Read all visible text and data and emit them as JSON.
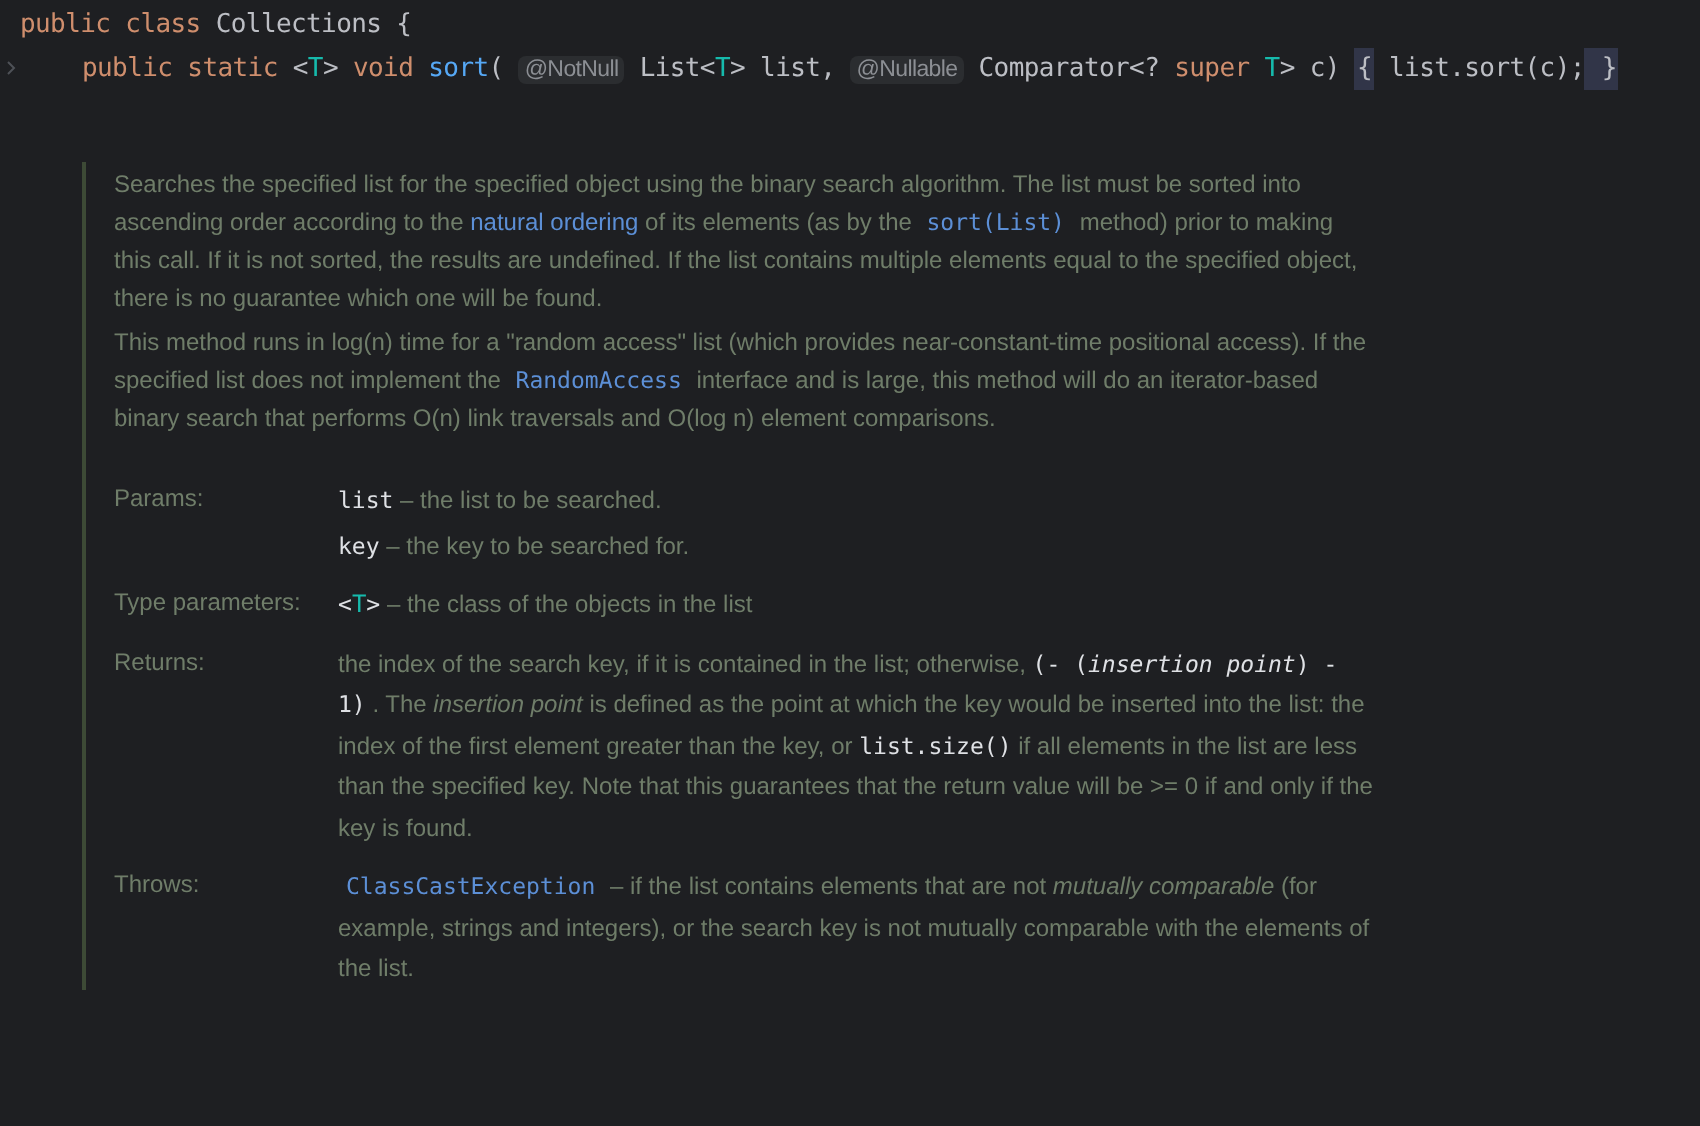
{
  "code_lines": [
    {
      "folded_gutter": false,
      "tokens": [
        {
          "kind": "keyword",
          "text": "public class "
        },
        {
          "kind": "plain",
          "text": "Collections {"
        }
      ],
      "children": [
        {
          "folded_gutter": true,
          "tokens": [
            {
              "kind": "keyword",
              "text": "public static "
            },
            {
              "kind": "plain",
              "text": "<"
            },
            {
              "kind": "typevar",
              "text": "T"
            },
            {
              "kind": "plain",
              "text": "> "
            },
            {
              "kind": "keyword",
              "text": "void "
            },
            {
              "kind": "method",
              "text": "sort"
            },
            {
              "kind": "plain",
              "text": "( "
            },
            {
              "kind": "annotation",
              "text": "@NotNull"
            },
            {
              "kind": "plain",
              "text": " List<"
            },
            {
              "kind": "typevar",
              "text": "T"
            },
            {
              "kind": "plain",
              "text": "> list, "
            },
            {
              "kind": "annotation",
              "text": "@Nullable"
            },
            {
              "kind": "plain",
              "text": " Comparator<? "
            },
            {
              "kind": "keyword",
              "text": "super "
            },
            {
              "kind": "typevar",
              "text": "T"
            },
            {
              "kind": "plain",
              "text": "> c) "
            },
            {
              "kind": "fold",
              "text": "{"
            },
            {
              "kind": "plain",
              "text": " list.sort(c);"
            },
            {
              "kind": "fold",
              "text": " }"
            }
          ]
        }
      ]
    }
  ],
  "doc": {
    "paragraphs": [
      [
        {
          "kind": "text",
          "text": "Searches the specified list for the specified object using the binary search algorithm. The list must be sorted into ascending order according to the "
        },
        {
          "kind": "link",
          "text": "natural ordering"
        },
        {
          "kind": "text",
          "text": " of its elements (as by the "
        },
        {
          "kind": "link-code",
          "text": "sort(List)"
        },
        {
          "kind": "text",
          "text": " method) prior to making this call. If it is not sorted, the results are undefined. If the list contains multiple elements equal to the specified object, there is no guarantee which one will be found."
        }
      ],
      [
        {
          "kind": "text",
          "text": "This method runs in log(n) time for a \"random access\" list (which provides near-constant-time positional access). If the specified list does not implement the "
        },
        {
          "kind": "link-code",
          "text": "RandomAccess"
        },
        {
          "kind": "text",
          "text": " interface and is large, this method will do an iterator-based binary search that performs O(n) link traversals and O(log n) element comparisons."
        }
      ]
    ],
    "sections": [
      {
        "label": "Params:",
        "entries": [
          [
            {
              "kind": "code",
              "text": "list"
            },
            {
              "kind": "text",
              "text": " – the list to be searched."
            }
          ],
          [
            {
              "kind": "code",
              "text": "key"
            },
            {
              "kind": "text",
              "text": " – the key to be searched for."
            }
          ]
        ]
      },
      {
        "label": "Type parameters:",
        "entries": [
          [
            {
              "kind": "code",
              "text": "<"
            },
            {
              "kind": "typevar",
              "text": "T"
            },
            {
              "kind": "code",
              "text": ">"
            },
            {
              "kind": "text",
              "text": " – the class of the objects in the list"
            }
          ]
        ]
      },
      {
        "label": "Returns:",
        "entries": [
          [
            {
              "kind": "text",
              "text": "the index of the search key, if it is contained in the list; otherwise, "
            },
            {
              "kind": "code",
              "text": "(- ("
            },
            {
              "kind": "code-italic",
              "text": "insertion point"
            },
            {
              "kind": "code",
              "text": ") - 1)"
            },
            {
              "kind": "text",
              "text": " . The "
            },
            {
              "kind": "italic",
              "text": "insertion point"
            },
            {
              "kind": "text",
              "text": " is defined as the point at which the key would be inserted into the list: the index of the first element greater than the key, or "
            },
            {
              "kind": "code",
              "text": "list.size()"
            },
            {
              "kind": "text",
              "text": " if all elements in the list are less than the specified key. Note that this guarantees that the return value will be >= 0 if and only if the key is found."
            }
          ]
        ]
      },
      {
        "label": "Throws:",
        "entries": [
          [
            {
              "kind": "link-code",
              "text": "ClassCastException"
            },
            {
              "kind": "text",
              "text": " – if the list contains elements that are not "
            },
            {
              "kind": "italic",
              "text": "mutually comparable"
            },
            {
              "kind": "text",
              "text": " (for example, strings and integers), or the search key is not mutually comparable with the elements of the list."
            }
          ]
        ]
      }
    ]
  }
}
